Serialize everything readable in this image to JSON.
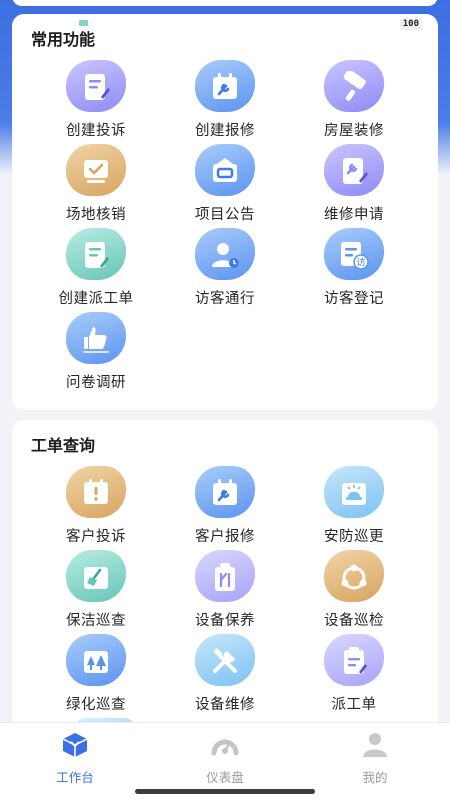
{
  "badge": "100",
  "section_common": {
    "title": "常用功能",
    "items": [
      {
        "label": "创建投诉",
        "icon": "document-edit-icon"
      },
      {
        "label": "创建报修",
        "icon": "repair-calendar-icon"
      },
      {
        "label": "房屋装修",
        "icon": "paint-roller-icon"
      },
      {
        "label": "场地核销",
        "icon": "checkbox-board-icon"
      },
      {
        "label": "项目公告",
        "icon": "announcement-icon"
      },
      {
        "label": "维修申请",
        "icon": "repair-request-icon"
      },
      {
        "label": "创建派工单",
        "icon": "dispatch-order-icon"
      },
      {
        "label": "访客通行",
        "icon": "visitor-pass-icon"
      },
      {
        "label": "访客登记",
        "icon": "visitor-register-icon"
      },
      {
        "label": "问卷调研",
        "icon": "thumbs-up-icon"
      }
    ],
    "visitor_tag": "访"
  },
  "section_query": {
    "title": "工单查询",
    "items": [
      {
        "label": "客户投诉",
        "icon": "complaint-icon"
      },
      {
        "label": "客户报修",
        "icon": "repair-calendar-icon"
      },
      {
        "label": "安防巡更",
        "icon": "security-patrol-icon"
      },
      {
        "label": "保洁巡查",
        "icon": "cleaning-icon"
      },
      {
        "label": "设备保养",
        "icon": "equipment-maintain-icon"
      },
      {
        "label": "设备巡检",
        "icon": "equipment-inspect-icon"
      },
      {
        "label": "绿化巡查",
        "icon": "greening-icon"
      },
      {
        "label": "设备维修",
        "icon": "tools-icon"
      },
      {
        "label": "派工单",
        "icon": "dispatch-list-icon"
      }
    ]
  },
  "tabs": [
    {
      "label": "工作台",
      "icon": "workbench-icon",
      "active": true
    },
    {
      "label": "仪表盘",
      "icon": "dashboard-icon",
      "active": false
    },
    {
      "label": "我的",
      "icon": "profile-icon",
      "active": false
    }
  ],
  "colors": {
    "accent": "#3b6fe6",
    "header_blue": "#4a7de8",
    "tab_idle": "#9b9b9b"
  }
}
